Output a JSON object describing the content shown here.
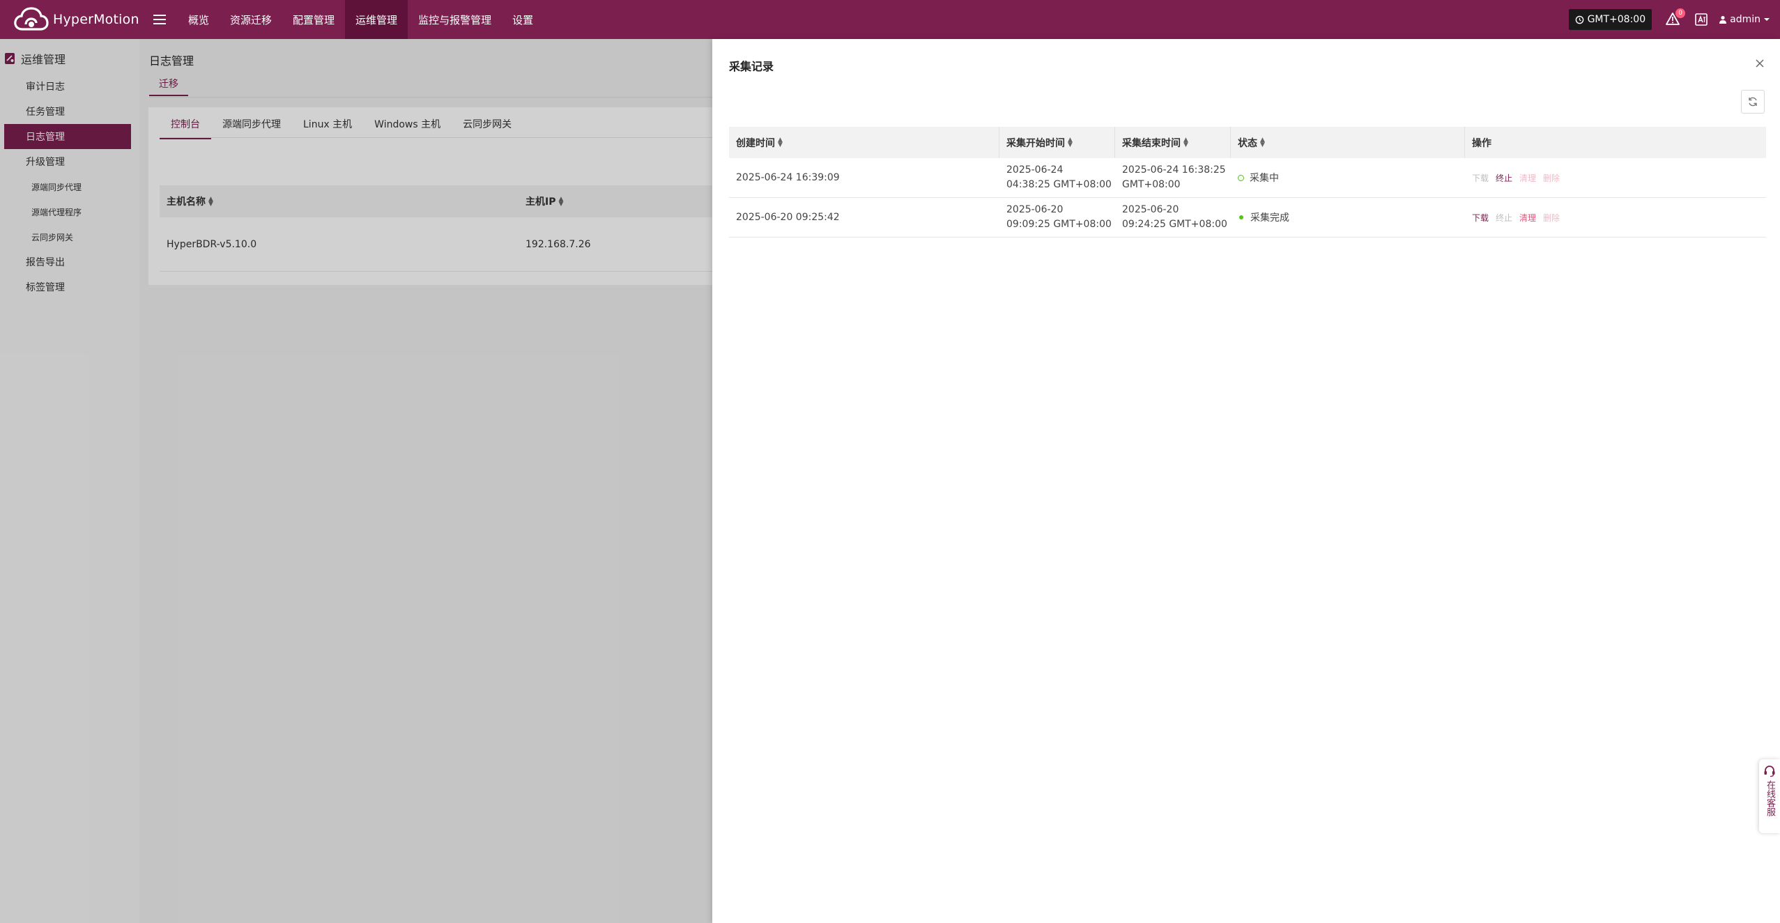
{
  "brand": {
    "name": "HyperMotion"
  },
  "nav": {
    "items": [
      {
        "label": "概览"
      },
      {
        "label": "资源迁移"
      },
      {
        "label": "配置管理"
      },
      {
        "label": "运维管理"
      },
      {
        "label": "监控与报警管理"
      },
      {
        "label": "设置"
      }
    ],
    "active_index": 3
  },
  "topbar": {
    "timezone": "GMT+08:00",
    "alert_count": "0",
    "user": "admin"
  },
  "sidebar": {
    "title": "运维管理",
    "items": [
      {
        "label": "审计日志"
      },
      {
        "label": "任务管理"
      },
      {
        "label": "日志管理"
      },
      {
        "label": "升级管理"
      },
      {
        "label": "源端同步代理"
      },
      {
        "label": "源端代理程序"
      },
      {
        "label": "云同步网关"
      },
      {
        "label": "报告导出"
      },
      {
        "label": "标签管理"
      }
    ]
  },
  "main": {
    "page_title": "日志管理",
    "migrate_tab": "迁移",
    "subtabs": [
      {
        "label": "控制台"
      },
      {
        "label": "源端同步代理"
      },
      {
        "label": "Linux 主机"
      },
      {
        "label": "Windows 主机"
      },
      {
        "label": "云同步网关"
      }
    ],
    "host_table": {
      "headers": [
        "主机名称",
        "主机IP"
      ],
      "rows": [
        {
          "name": "HyperBDR-v5.10.0",
          "ip": "192.168.7.26"
        }
      ]
    }
  },
  "drawer": {
    "title": "采集记录",
    "headers": {
      "created": "创建时间",
      "start": "采集开始时间",
      "end": "采集结束时间",
      "status": "状态",
      "actions": "操作"
    },
    "rows": [
      {
        "created": "2025-06-24 16:39:09",
        "start_1": "2025-06-24",
        "start_2": "04:38:25 GMT+08:00",
        "end_1": "2025-06-24 16:38:25",
        "end_2": "GMT+08:00",
        "status": "采集中",
        "status_color": "#52c41a"
      },
      {
        "created": "2025-06-20 09:25:42",
        "start_1": "2025-06-20",
        "start_2": "09:09:25 GMT+08:00",
        "end_1": "2025-06-20",
        "end_2": "09:24:25 GMT+08:00",
        "status": "采集完成",
        "status_color": "#52c41a"
      }
    ],
    "actions": {
      "download": "下载",
      "stop": "终止",
      "clean": "清理",
      "delete": "删除"
    }
  },
  "support": {
    "label": "在线客服"
  },
  "colors": {
    "brand": "#7b1f4f",
    "brand_dark": "#5e1239",
    "success": "#52c41a"
  }
}
